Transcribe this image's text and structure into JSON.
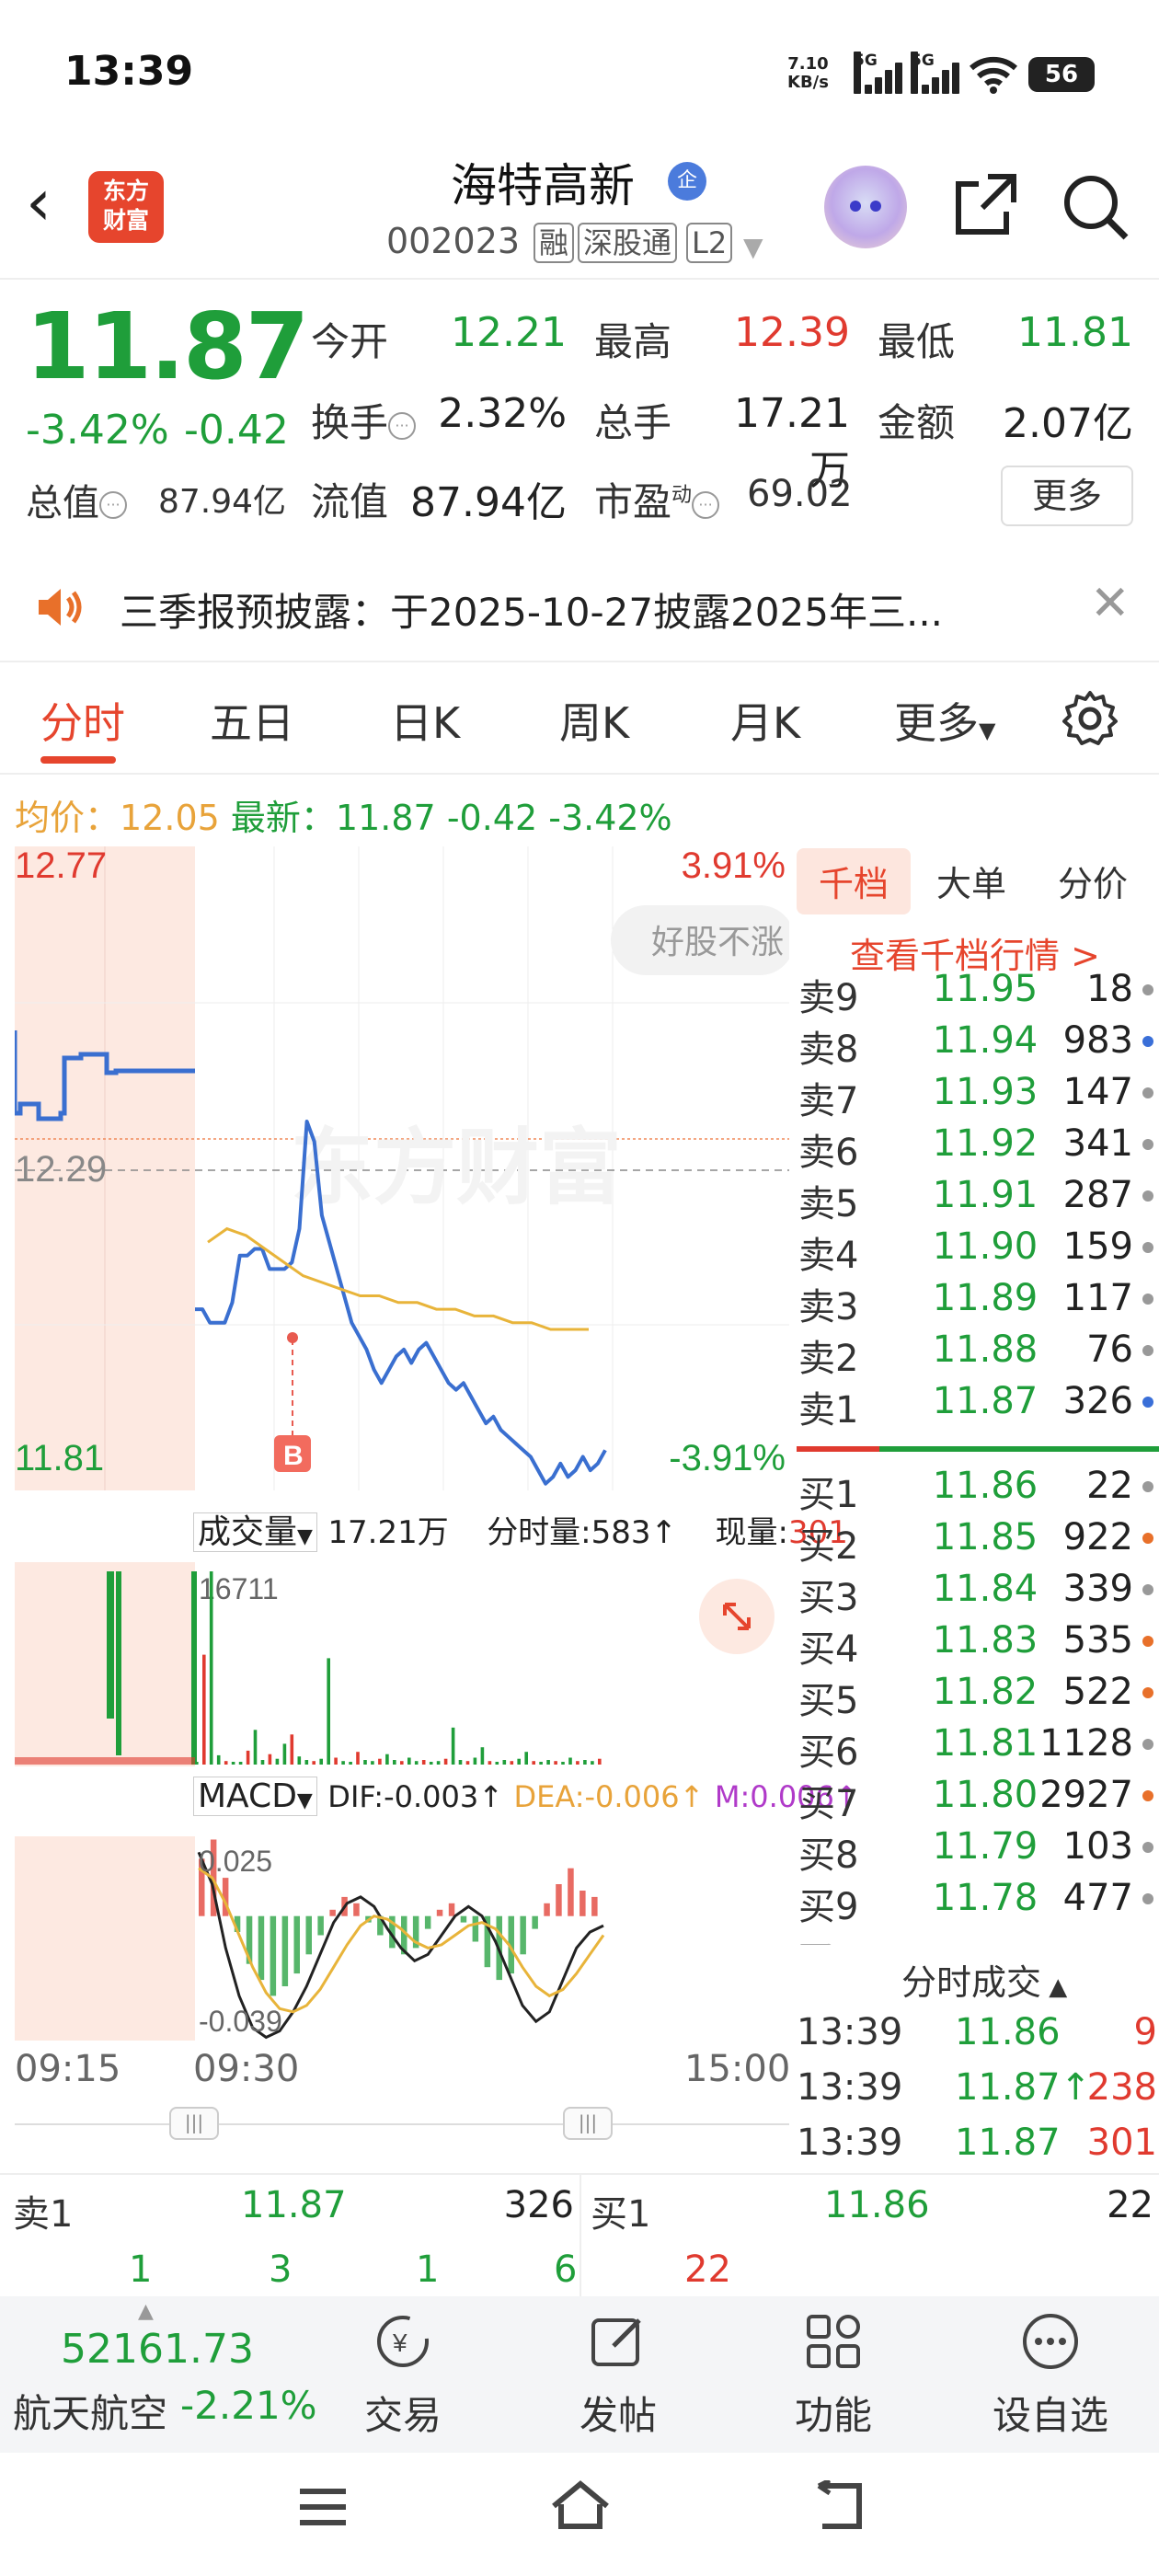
{
  "status": {
    "time": "13:39",
    "net_rate": "7.10",
    "net_unit": "KB/s",
    "sig1": "5G",
    "sig2": "5G",
    "battery": "56"
  },
  "header": {
    "back": "‹",
    "logo_line1": "东方",
    "logo_line2": "财富",
    "name": "海特高新",
    "name_badge": "企",
    "code": "002023",
    "tags": [
      "融",
      "深股通",
      "L2"
    ]
  },
  "quote": {
    "price": "11.87",
    "chg_pct": "-3.42%",
    "chg": "-0.42",
    "open_label": "今开",
    "open": "12.21",
    "high_label": "最高",
    "high": "12.39",
    "low_label": "最低",
    "low": "11.81",
    "turnover_label": "换手",
    "turnover": "2.32%",
    "volume_label": "总手",
    "volume": "17.21万",
    "amount_label": "金额",
    "amount": "2.07亿",
    "mcap_label": "总值",
    "mcap": "87.94亿",
    "float_label": "流值",
    "float": "87.94亿",
    "pe_label": "市盈",
    "pe_sup": "动",
    "pe": "69.02",
    "more": "更多"
  },
  "notice": {
    "text": "三季报预披露：于2025-10-27披露2025年三..."
  },
  "tabs": [
    "分时",
    "五日",
    "日K",
    "周K",
    "月K",
    "更多"
  ],
  "avg": {
    "label": "均价：",
    "value": "12.05",
    "latest_label": "最新：",
    "latest": "11.87",
    "chg": "-0.42",
    "pct": "-3.42%"
  },
  "chart": {
    "y_top": "12.77",
    "y_mid": "12.29",
    "y_bot": "11.81",
    "pct_top": "3.91%",
    "pct_bot": "-3.91%",
    "watermark": "东方财富",
    "bubble": "好股不涨",
    "marker": "B",
    "vol_label": "成交量",
    "vol_total": "17.21万",
    "vol_step_label": "分时量:583",
    "vol_now_label": "现量:",
    "vol_now": "301",
    "vol_max": "16711",
    "macd_label": "MACD",
    "dif": "DIF:-0.003",
    "dea": "DEA:-0.006",
    "m": "M:0.006",
    "macd_top": "0.025",
    "macd_bot": "-0.039",
    "time_start": "09:15",
    "time_mid": "09:30",
    "time_end": "15:00",
    "price_series": [
      12.08,
      12.08,
      12.06,
      12.06,
      12.06,
      12.09,
      12.16,
      12.16,
      12.17,
      12.17,
      12.14,
      12.14,
      12.14,
      12.15,
      12.2,
      12.36,
      12.33,
      12.22,
      12.18,
      12.14,
      12.1,
      12.06,
      12.04,
      12.02,
      11.99,
      11.97,
      11.99,
      12.01,
      12.02,
      12.0,
      12.02,
      12.03,
      12.01,
      11.99,
      11.97,
      11.96,
      11.97,
      11.95,
      11.93,
      11.91,
      11.92,
      11.9,
      11.89,
      11.88,
      11.87,
      11.86,
      11.84,
      11.82,
      11.83,
      11.85,
      11.83,
      11.84,
      11.86,
      11.84,
      11.85,
      11.87
    ],
    "avg_series": [
      12.18,
      12.2,
      12.19,
      12.17,
      12.15,
      12.13,
      12.12,
      12.11,
      12.1,
      12.1,
      12.09,
      12.09,
      12.08,
      12.08,
      12.07,
      12.07,
      12.06,
      12.06,
      12.05,
      12.05,
      12.05
    ],
    "vol_series": [
      120,
      9500,
      16711,
      800,
      300,
      200,
      150,
      1200,
      3000,
      400,
      900,
      500,
      1800,
      2600,
      700,
      400,
      300,
      500,
      9200,
      600,
      300,
      200,
      1100,
      400,
      300,
      500,
      900,
      400,
      300,
      600,
      300,
      400,
      200,
      300,
      500,
      3200,
      400,
      300,
      600,
      1500,
      300,
      200,
      400,
      300,
      500,
      1100,
      300,
      200,
      400,
      300,
      200,
      600,
      300,
      400,
      300,
      500
    ],
    "macd_series": [
      0.018,
      0.024,
      0.012,
      -0.005,
      -0.015,
      -0.02,
      -0.025,
      -0.022,
      -0.018,
      -0.012,
      -0.006,
      0.002,
      0.006,
      0.004,
      -0.002,
      -0.006,
      -0.01,
      -0.012,
      -0.01,
      -0.004,
      0.002,
      0.004,
      -0.002,
      -0.008,
      -0.016,
      -0.02,
      -0.018,
      -0.012,
      -0.004,
      0.004,
      0.01,
      0.015,
      0.008,
      0.006
    ],
    "dif_series": [
      0.02,
      0.01,
      -0.01,
      -0.025,
      -0.035,
      -0.038,
      -0.036,
      -0.03,
      -0.022,
      -0.012,
      -0.002,
      0.004,
      0.006,
      0.003,
      -0.004,
      -0.01,
      -0.014,
      -0.012,
      -0.006,
      0.0,
      0.003,
      0.0,
      -0.008,
      -0.018,
      -0.028,
      -0.033,
      -0.03,
      -0.02,
      -0.01,
      -0.005,
      -0.003
    ],
    "dea_series": [
      0.015,
      0.012,
      0.004,
      -0.006,
      -0.016,
      -0.024,
      -0.029,
      -0.03,
      -0.028,
      -0.023,
      -0.016,
      -0.009,
      -0.003,
      0.0,
      -0.001,
      -0.004,
      -0.008,
      -0.01,
      -0.009,
      -0.006,
      -0.003,
      -0.002,
      -0.004,
      -0.009,
      -0.016,
      -0.022,
      -0.025,
      -0.023,
      -0.018,
      -0.012,
      -0.006
    ]
  },
  "orderbook": {
    "tabs": [
      "千档",
      "大单",
      "分价"
    ],
    "link": "查看千档行情 >",
    "asks": [
      {
        "label": "卖9",
        "price": "11.95",
        "qty": "18",
        "dot": "#999"
      },
      {
        "label": "卖8",
        "price": "11.94",
        "qty": "983",
        "dot": "#3a6fd8"
      },
      {
        "label": "卖7",
        "price": "11.93",
        "qty": "147",
        "dot": "#999"
      },
      {
        "label": "卖6",
        "price": "11.92",
        "qty": "341",
        "dot": "#999"
      },
      {
        "label": "卖5",
        "price": "11.91",
        "qty": "287",
        "dot": "#999"
      },
      {
        "label": "卖4",
        "price": "11.90",
        "qty": "159",
        "dot": "#999"
      },
      {
        "label": "卖3",
        "price": "11.89",
        "qty": "117",
        "dot": "#999"
      },
      {
        "label": "卖2",
        "price": "11.88",
        "qty": "76",
        "dot": "#999"
      },
      {
        "label": "卖1",
        "price": "11.87",
        "qty": "326",
        "dot": "#3a6fd8"
      }
    ],
    "bids": [
      {
        "label": "买1",
        "price": "11.86",
        "qty": "22",
        "dot": "#999"
      },
      {
        "label": "买2",
        "price": "11.85",
        "qty": "922",
        "dot": "#e8702a"
      },
      {
        "label": "买3",
        "price": "11.84",
        "qty": "339",
        "dot": "#999"
      },
      {
        "label": "买4",
        "price": "11.83",
        "qty": "535",
        "dot": "#e8702a"
      },
      {
        "label": "买5",
        "price": "11.82",
        "qty": "522",
        "dot": "#e8702a"
      },
      {
        "label": "买6",
        "price": "11.81",
        "qty": "1128",
        "dot": "#999"
      },
      {
        "label": "买7",
        "price": "11.80",
        "qty": "2927",
        "dot": "#e8702a"
      },
      {
        "label": "买8",
        "price": "11.79",
        "qty": "103",
        "dot": "#999"
      },
      {
        "label": "买9",
        "price": "11.78",
        "qty": "477",
        "dot": "#999"
      }
    ],
    "trades_title": "分时成交",
    "trades": [
      {
        "time": "13:39",
        "price": "11.86",
        "vol": "9"
      },
      {
        "time": "13:39",
        "price": "11.87↑",
        "vol": "238"
      },
      {
        "time": "13:39",
        "price": "11.87",
        "vol": "301"
      }
    ]
  },
  "strip": {
    "sell_label": "卖1",
    "sell_price": "11.87",
    "sell_qty": "326",
    "buy_label": "买1",
    "buy_price": "11.86",
    "buy_qty": "22",
    "sell_splits": [
      "1",
      "3",
      "1",
      "6"
    ],
    "buy_splits": [
      "22"
    ]
  },
  "toolbar": {
    "index_value": "52161.73",
    "index_name": "航天航空",
    "index_chg": "-2.21%",
    "items": [
      "交易",
      "发帖",
      "功能",
      "设自选"
    ]
  }
}
